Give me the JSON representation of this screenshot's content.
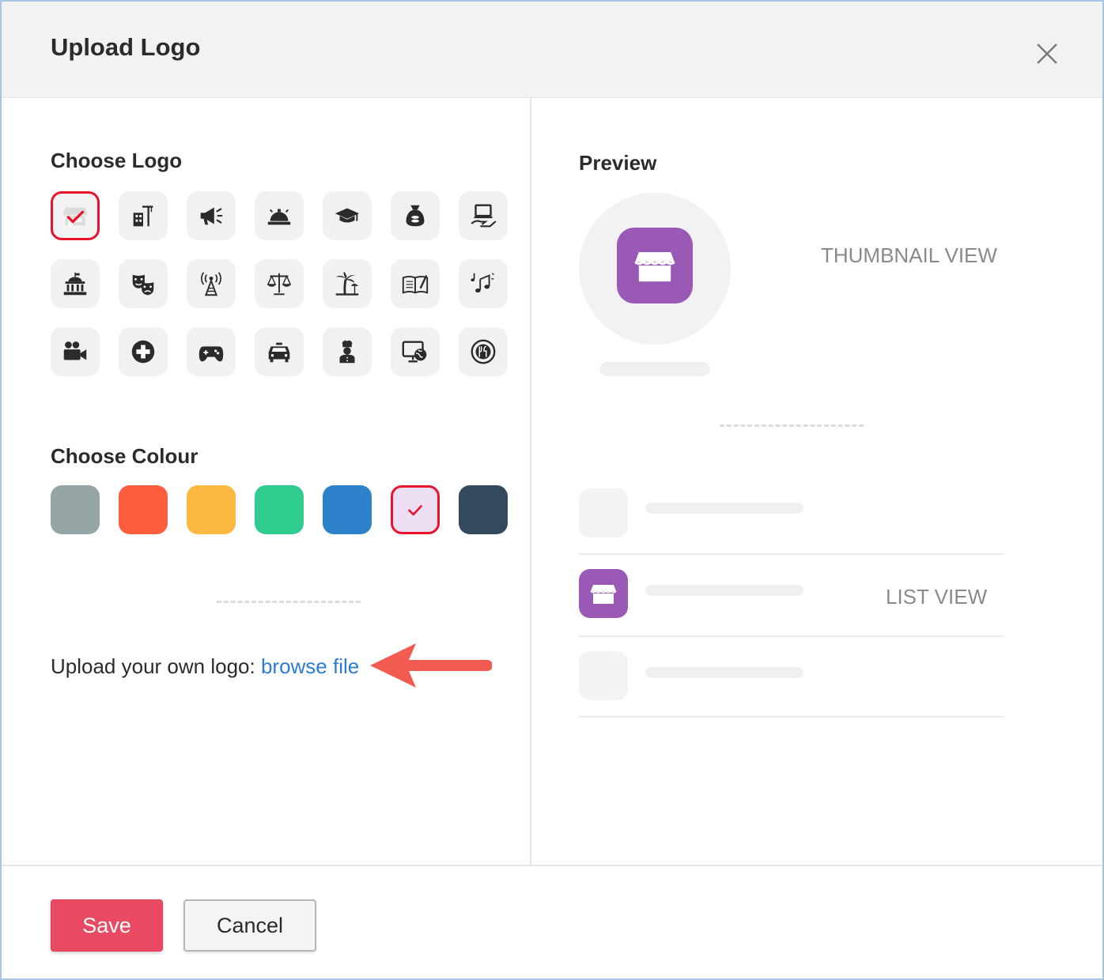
{
  "dialog": {
    "title": "Upload Logo",
    "close_icon": "close-icon"
  },
  "choose_logo": {
    "title": "Choose Logo",
    "selected_index": 0,
    "icons": [
      "store-icon",
      "building-crane-icon",
      "megaphone-icon",
      "service-bell-icon",
      "graduation-cap-icon",
      "money-bag-icon",
      "laptop-hand-icon",
      "government-building-icon",
      "theater-masks-icon",
      "radio-tower-icon",
      "justice-scale-icon",
      "palm-beach-icon",
      "open-book-icon",
      "music-notes-icon",
      "video-camera-icon",
      "medical-cross-icon",
      "gamepad-icon",
      "taxi-icon",
      "chef-icon",
      "monitor-globe-icon",
      "dining-plate-icon"
    ]
  },
  "choose_colour": {
    "title": "Choose Colour",
    "selected_index": 5,
    "colors": [
      "#95a5a6",
      "#fe5e3f",
      "#fbb942",
      "#2ecc8f",
      "#2e82cc",
      "#9b59b6",
      "#34495e"
    ],
    "selected_fill": "#ecdff3"
  },
  "upload": {
    "label": "Upload your own logo:",
    "link": "browse file"
  },
  "preview": {
    "title": "Preview",
    "thumbnail_label": "THUMBNAIL VIEW",
    "list_label": "LIST VIEW",
    "logo_color": "#9b59b6"
  },
  "footer": {
    "save_label": "Save",
    "cancel_label": "Cancel"
  }
}
